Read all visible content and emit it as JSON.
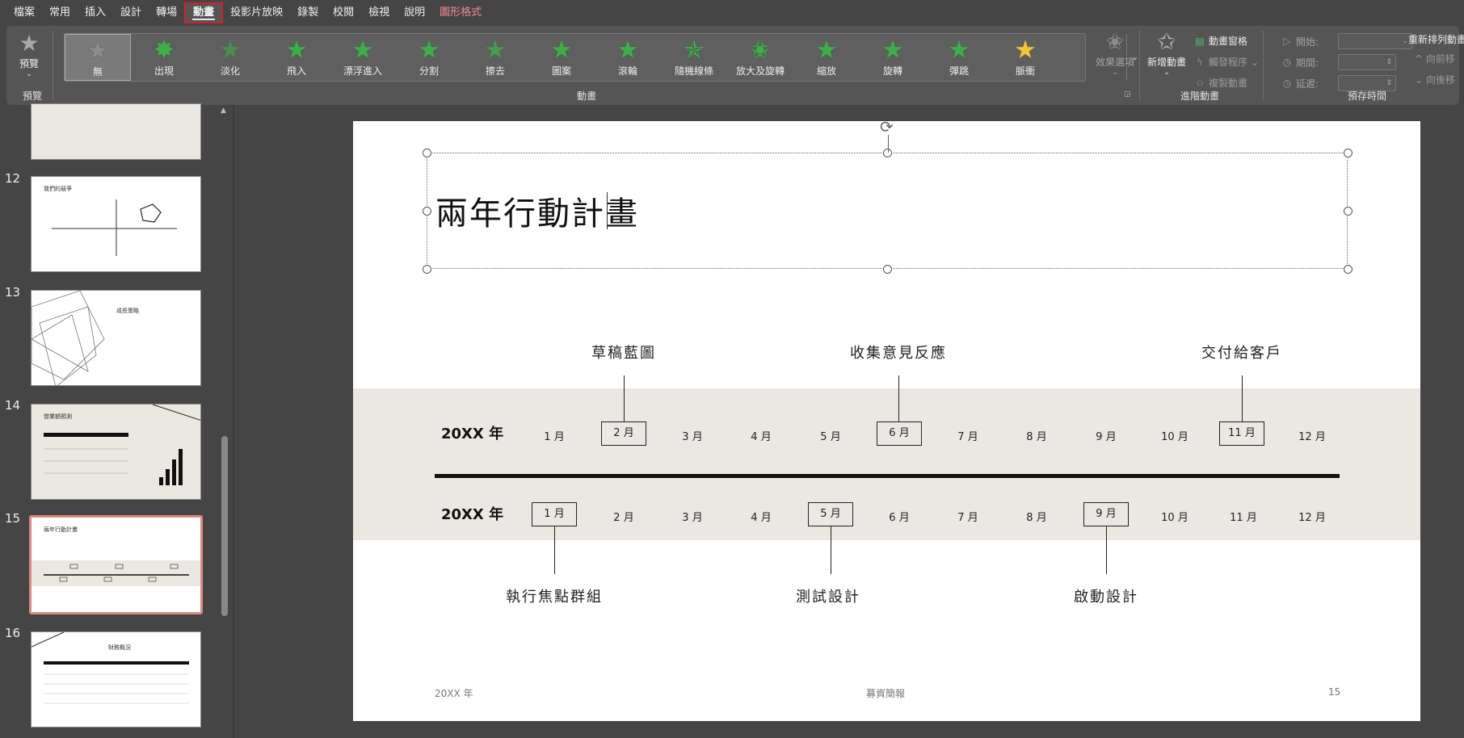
{
  "menu": {
    "items": [
      "檔案",
      "常用",
      "插入",
      "設計",
      "轉場",
      "動畫",
      "投影片放映",
      "錄製",
      "校閱",
      "檢視",
      "說明",
      "圖形格式"
    ],
    "active_index": 5
  },
  "ribbon": {
    "preview_button": "預覽",
    "preview_group": "預覽",
    "animation_group": "動畫",
    "animations": [
      "無",
      "出現",
      "淡化",
      "飛入",
      "漂浮進入",
      "分割",
      "擦去",
      "圖案",
      "滾輪",
      "隨機線條",
      "放大及旋轉",
      "縮放",
      "旋轉",
      "彈跳",
      "脈衝"
    ],
    "effect_options": "效果選項",
    "add_animation": "新增動畫",
    "advanced_group": "進階動畫",
    "animation_pane": "動畫窗格",
    "trigger": "觸發程序",
    "copy_animation": "複製動畫",
    "timing_group": "預存時間",
    "start": "開始:",
    "duration": "期間:",
    "delay": "延遲:",
    "reorder_title": "重新排列動畫",
    "move_earlier": "向前移",
    "move_later": "向後移"
  },
  "thumbnails": {
    "numbers": [
      "12",
      "13",
      "14",
      "15",
      "16"
    ],
    "slide12_title": "我們的競爭",
    "slide13_title": "成長策略",
    "slide14_title": "營業額預測",
    "slide15_title": "兩年行動計畫",
    "slide16_title": "財務概況"
  },
  "slide": {
    "title": "兩年行動計畫",
    "year1": "20XX 年",
    "year2": "20XX 年",
    "months": [
      "1 月",
      "2 月",
      "3 月",
      "4 月",
      "5 月",
      "6 月",
      "7 月",
      "8 月",
      "9 月",
      "10 月",
      "11 月",
      "12 月"
    ],
    "top_milestones": [
      "草稿藍圖",
      "收集意見反應",
      "交付給客戶"
    ],
    "bottom_milestones": [
      "執行焦點群組",
      "測試設計",
      "啟動設計"
    ],
    "footer_left": "20XX 年",
    "footer_center": "募資簡報",
    "footer_right": "15"
  }
}
